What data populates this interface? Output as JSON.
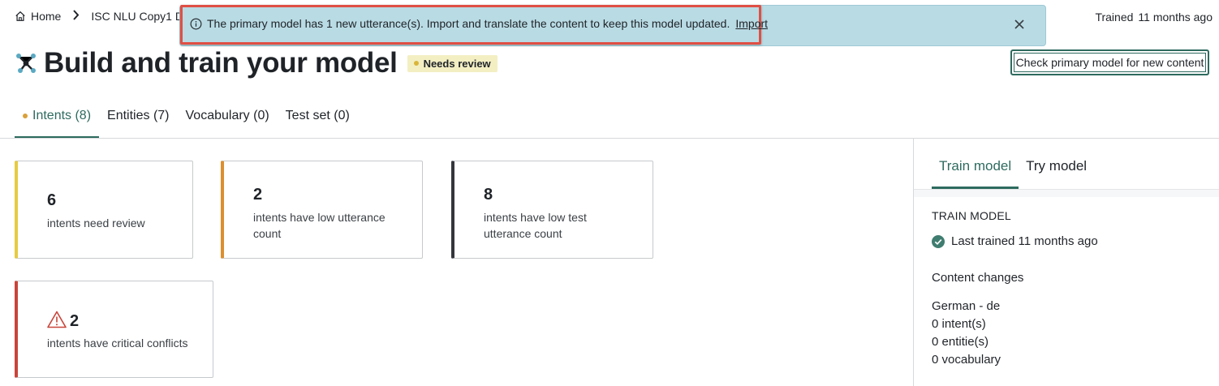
{
  "breadcrumb": {
    "home_label": "Home",
    "model_label": "ISC NLU Copy1 DE -"
  },
  "trained_status": {
    "label": "Trained",
    "value": "11 months ago"
  },
  "banner": {
    "message": "The primary model has 1 new utterance(s). Import and translate the content to keep this model updated.",
    "link_label": "Import"
  },
  "header": {
    "title": "Build and train your model",
    "badge": "Needs review",
    "check_button": "Check primary model for new content"
  },
  "tabs": [
    {
      "label": "Intents (8)",
      "active": true
    },
    {
      "label": "Entities (7)",
      "active": false
    },
    {
      "label": "Vocabulary (0)",
      "active": false
    },
    {
      "label": "Test set (0)",
      "active": false
    }
  ],
  "cards": [
    {
      "count": "6",
      "label": "intents need review",
      "accent": "#e5cb43"
    },
    {
      "count": "2",
      "label": "intents have low utterance count",
      "accent": "#dc8f2f"
    },
    {
      "count": "8",
      "label": "intents have low test utterance count",
      "accent": "#33373b"
    },
    {
      "count": "2",
      "label": "intents have critical conflicts",
      "accent": "#c8453a",
      "icon": "warning-icon"
    }
  ],
  "side_panel": {
    "tabs": [
      {
        "label": "Train model",
        "active": true
      },
      {
        "label": "Try model",
        "active": false
      }
    ],
    "section_title": "TRAIN MODEL",
    "last_trained": "Last trained 11 months ago",
    "changes_title": "Content changes",
    "changes": {
      "language": "German - de",
      "intents": "0 intent(s)",
      "entities": "0 entitie(s)",
      "vocabulary": "0 vocabulary"
    }
  },
  "colors": {
    "accent": "#2e6b5f",
    "banner_bg": "#b9dbe4",
    "highlight": "#e04f44"
  }
}
